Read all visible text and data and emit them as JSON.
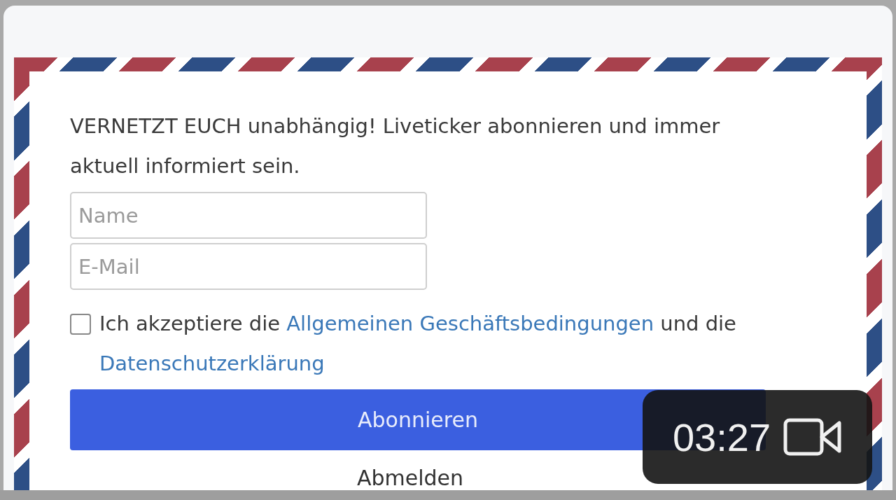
{
  "intro": "VERNETZT EUCH unabhängig! Liveticker abonnieren und immer aktuell informiert sein.",
  "fields": [
    {
      "placeholder": "Name"
    },
    {
      "placeholder": "E-Mail"
    }
  ],
  "consent": {
    "checked": false,
    "before": "Ich akzeptiere die ",
    "terms_link": "Allgemeinen Geschäftsbedingungen",
    "middle": " und die ",
    "privacy_link": "Datenschutzerklärung"
  },
  "subscribe_button": "Abonnieren",
  "unsubscribe_link": "Abmelden",
  "video_badge": {
    "time": "03:27"
  }
}
